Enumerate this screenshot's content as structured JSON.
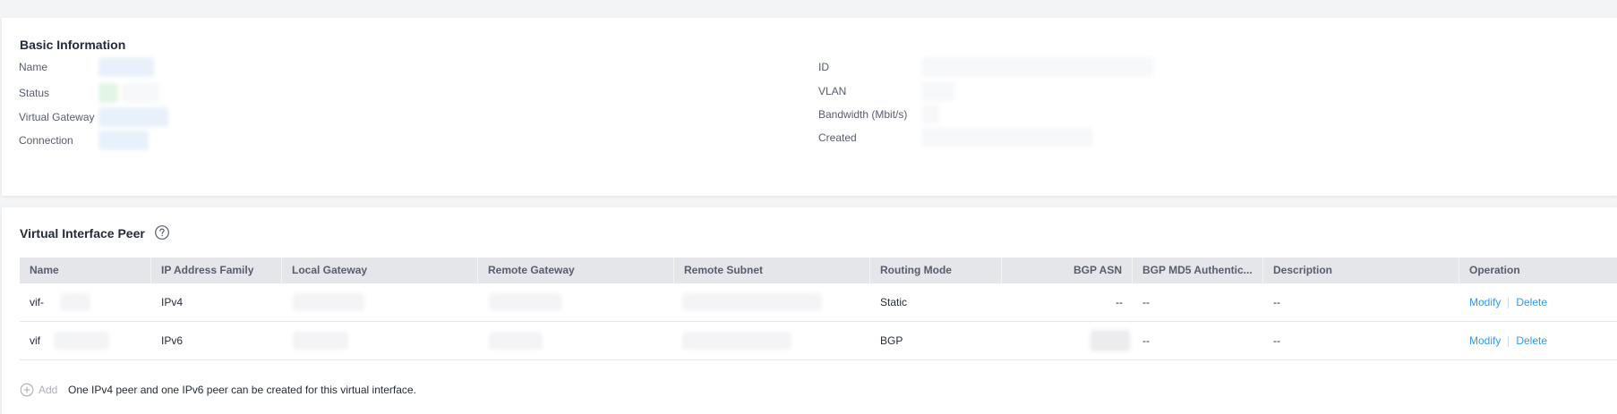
{
  "basic_info": {
    "title": "Basic Information",
    "left_fields": [
      {
        "label": "Name"
      },
      {
        "label": "Status"
      },
      {
        "label": "Virtual Gateway"
      },
      {
        "label": "Connection"
      }
    ],
    "right_fields": [
      {
        "label": "ID"
      },
      {
        "label": "VLAN"
      },
      {
        "label": "Bandwidth (Mbit/s)"
      },
      {
        "label": "Created"
      }
    ]
  },
  "peer": {
    "title": "Virtual Interface Peer",
    "help_icon": "help-circle-icon",
    "columns": [
      "Name",
      "IP Address Family",
      "Local Gateway",
      "Remote Gateway",
      "Remote Subnet",
      "Routing Mode",
      "BGP ASN",
      "BGP MD5 Authentic...",
      "Description",
      "Operation"
    ],
    "rows": [
      {
        "name": "vif-",
        "family": "IPv4",
        "routing": "Static",
        "asn": "--",
        "md5": "--",
        "description": "--",
        "modify": "Modify",
        "delete": "Delete"
      },
      {
        "name": "vif",
        "family": "IPv6",
        "routing": "BGP",
        "asn": "",
        "md5": "--",
        "description": "--",
        "modify": "Modify",
        "delete": "Delete"
      }
    ],
    "add_label": "Add",
    "add_icon": "plus-circle-icon",
    "add_hint": "One IPv4 peer and one IPv6 peer can be created for this virtual interface."
  },
  "colors": {
    "link": "#3399e8",
    "header_bg": "#e4e6e9",
    "page_bg": "#f3f4f6"
  }
}
